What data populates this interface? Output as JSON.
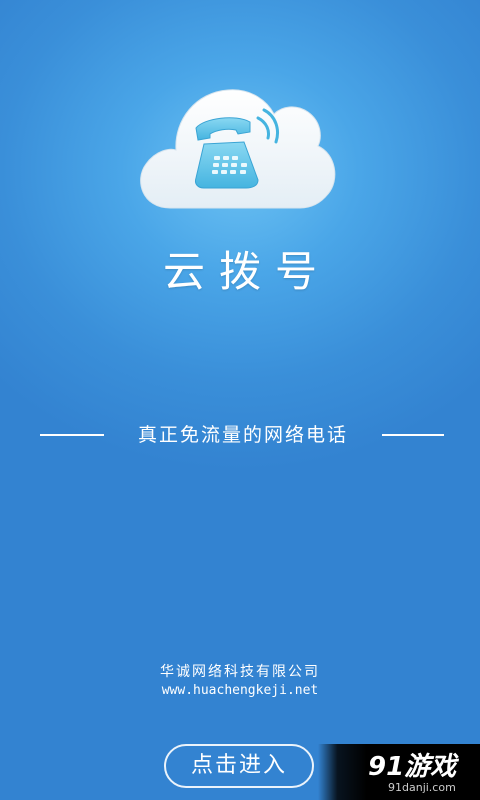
{
  "splash": {
    "app_name": "云拨号",
    "tagline": "真正免流量的网络电话",
    "company": {
      "name": "华诚网络科技有限公司",
      "url": "www.huachengkeji.net"
    },
    "enter_button_label": "点击进入"
  },
  "logo": {
    "icon": "cloud-phone-icon"
  },
  "watermark": {
    "brand": "91游戏",
    "site": "91danji.com"
  },
  "colors": {
    "background": "#3a8fd9",
    "glow": "#6cc2f3",
    "text": "#ffffff",
    "logo_cloud": "#ffffff",
    "logo_phone": "#5cc3e8"
  }
}
